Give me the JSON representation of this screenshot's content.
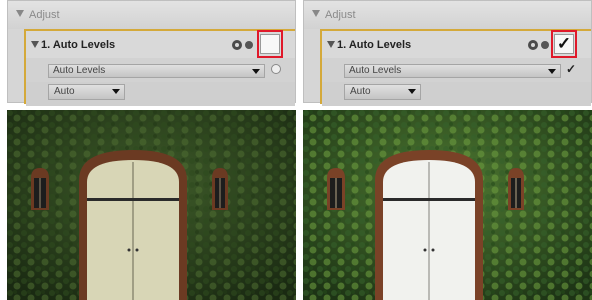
{
  "panels": [
    {
      "section_title": "Adjust",
      "step_title": "1. Auto Levels",
      "enabled_checked": false,
      "checkbox_glyph": "",
      "method_select": "Auto Levels",
      "mode_select": "Auto"
    },
    {
      "section_title": "Adjust",
      "step_title": "1. Auto Levels",
      "enabled_checked": true,
      "checkbox_glyph": "✓",
      "method_select": "Auto Levels",
      "mode_select": "Auto"
    }
  ],
  "colors": {
    "highlight_border": "#e0192a",
    "step_border": "#d4a93a",
    "panel_bg": "#d6d6d6"
  },
  "photos": [
    {
      "state": "before"
    },
    {
      "state": "after"
    }
  ]
}
